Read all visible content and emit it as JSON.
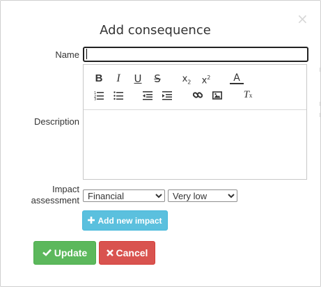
{
  "dialog": {
    "title": "Add consequence",
    "close_glyph": "×"
  },
  "form": {
    "name_label": "Name",
    "name_value": "",
    "description_label": "Description",
    "description_value": "",
    "impact_label": "Impact assessment",
    "impact_type_selected": "Financial",
    "impact_level_selected": "Very low",
    "add_impact_label": "Add new impact"
  },
  "editor_toolbar": {
    "row1": [
      "bold-icon",
      "italic-icon",
      "underline-icon",
      "strikethrough-icon",
      "subscript-icon",
      "superscript-icon",
      "text-color-icon"
    ],
    "row2": [
      "numbered-list-icon",
      "bulleted-list-icon",
      "outdent-icon",
      "indent-icon",
      "link-icon",
      "image-icon",
      "remove-format-icon"
    ]
  },
  "actions": {
    "update_label": "Update",
    "cancel_label": "Cancel"
  },
  "colors": {
    "update": "#5cb85c",
    "cancel": "#d9534f",
    "add_impact": "#5bc0de"
  }
}
